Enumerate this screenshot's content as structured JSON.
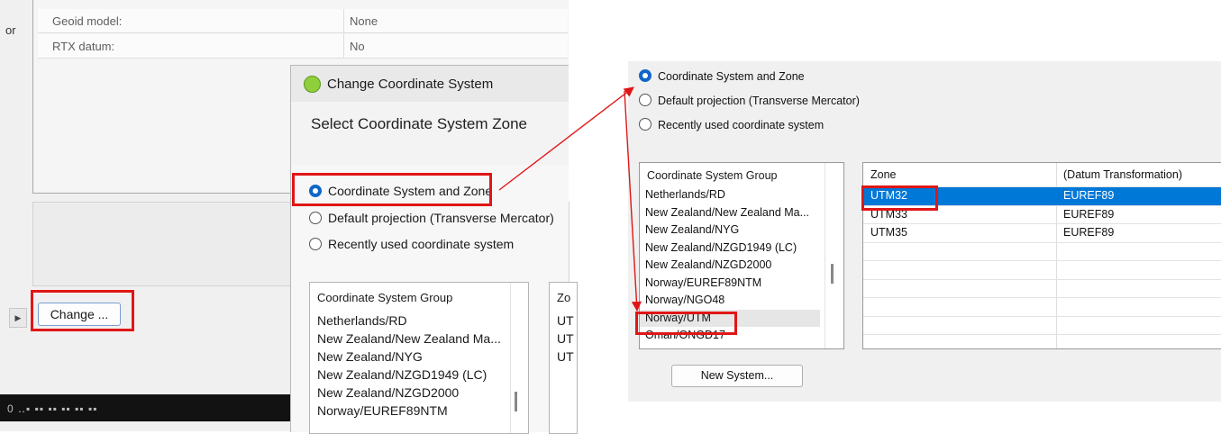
{
  "background_window": {
    "edge_text": "or",
    "properties": [
      {
        "label": "Geoid model:",
        "value": "None"
      },
      {
        "label": "RTX datum:",
        "value": "No"
      }
    ],
    "change_button": "Change ...",
    "timeline_text": "0 ‥▪ ▪▪ ▪▪ ▪▪ ▪▪ ▪▪"
  },
  "dialog": {
    "title": "Change Coordinate System",
    "heading": "Select Coordinate System Zone",
    "radio_options": [
      {
        "label": "Coordinate System and Zone",
        "checked": true
      },
      {
        "label": "Default projection (Transverse Mercator)",
        "checked": false
      },
      {
        "label": "Recently used coordinate system",
        "checked": false
      }
    ],
    "group_header": "Coordinate System Group",
    "zone_header_partial": "Zo",
    "groups": [
      "Netherlands/RD",
      "New Zealand/New Zealand Ma...",
      "New Zealand/NYG",
      "New Zealand/NZGD1949 (LC)",
      "New Zealand/NZGD2000",
      "Norway/EUREF89NTM"
    ],
    "zone_partials": [
      "UT",
      "UT",
      "UT"
    ]
  },
  "zoom": {
    "radio_options": [
      {
        "label": "Coordinate System and Zone",
        "checked": true
      },
      {
        "label": "Default projection (Transverse Mercator)",
        "checked": false
      },
      {
        "label": "Recently used coordinate system",
        "checked": false
      }
    ],
    "group_header": "Coordinate System Group",
    "groups": [
      "Netherlands/RD",
      "New Zealand/New Zealand Ma...",
      "New Zealand/NYG",
      "New Zealand/NZGD1949 (LC)",
      "New Zealand/NZGD2000",
      "Norway/EUREF89NTM",
      "Norway/NGO48",
      "Norway/UTM",
      "Oman/ONGD17"
    ],
    "zone_headers": {
      "zone": "Zone",
      "datum": "(Datum Transformation)"
    },
    "zones": [
      {
        "zone": "UTM32",
        "datum": "EUREF89",
        "selected": true
      },
      {
        "zone": "UTM33",
        "datum": "EUREF89",
        "selected": false
      },
      {
        "zone": "UTM35",
        "datum": "EUREF89",
        "selected": false
      }
    ],
    "new_system_button": "New System..."
  },
  "colors": {
    "highlight": "#e01616",
    "selection": "#0078d7",
    "radio_checked": "#1066c8"
  }
}
